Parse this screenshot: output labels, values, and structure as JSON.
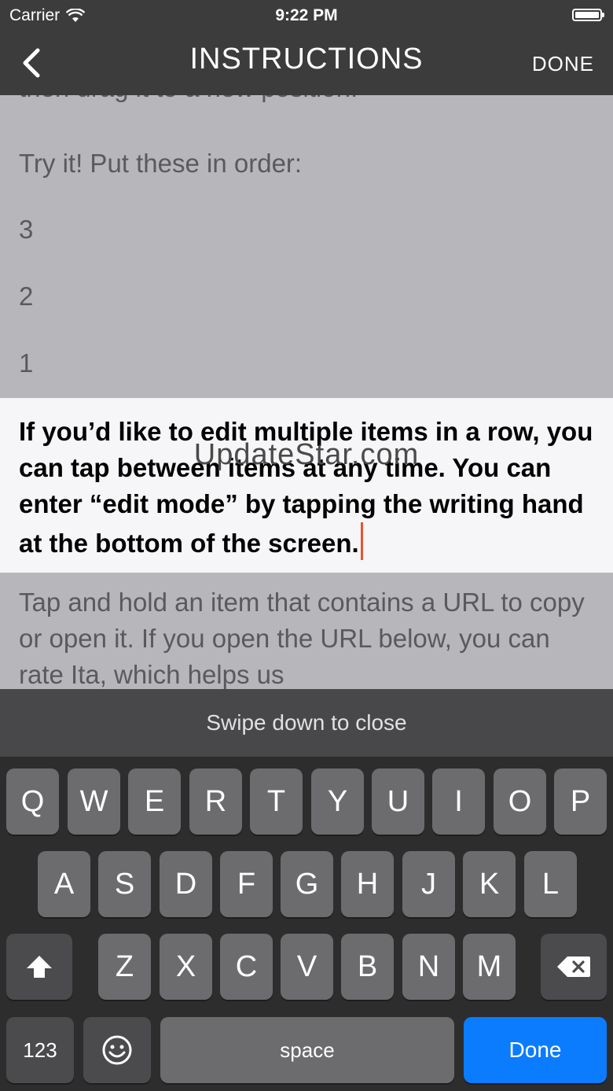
{
  "status": {
    "carrier": "Carrier",
    "time": "9:22 PM"
  },
  "nav": {
    "title": "INSTRUCTIONS",
    "done": "DONE"
  },
  "content": {
    "clipped_line": "then drag it to a new position.",
    "try_line": "Try it! Put these in order:",
    "items": [
      "3",
      "2",
      "1"
    ],
    "editing_text": "If you’d like to edit multiple items in a row, you can tap between items at any time. You can enter “edit mode” by tapping the writing hand at the bottom of the screen.",
    "lower_text": "Tap and hold an item that contains a URL to copy or open it. If you open the URL below, you can rate Ita, which helps us"
  },
  "watermark": "UpdateStar.com",
  "keyboard": {
    "bar_hint": "Swipe down to close",
    "row1": [
      "Q",
      "W",
      "E",
      "R",
      "T",
      "Y",
      "U",
      "I",
      "O",
      "P"
    ],
    "row2": [
      "A",
      "S",
      "D",
      "F",
      "G",
      "H",
      "J",
      "K",
      "L"
    ],
    "row3": [
      "Z",
      "X",
      "C",
      "V",
      "B",
      "N",
      "M"
    ],
    "numbers": "123",
    "space": "space",
    "done": "Done"
  },
  "colors": {
    "accent": "#0a7cfd",
    "cursor": "#e8552f",
    "nav_bg": "#3c3c3d"
  }
}
